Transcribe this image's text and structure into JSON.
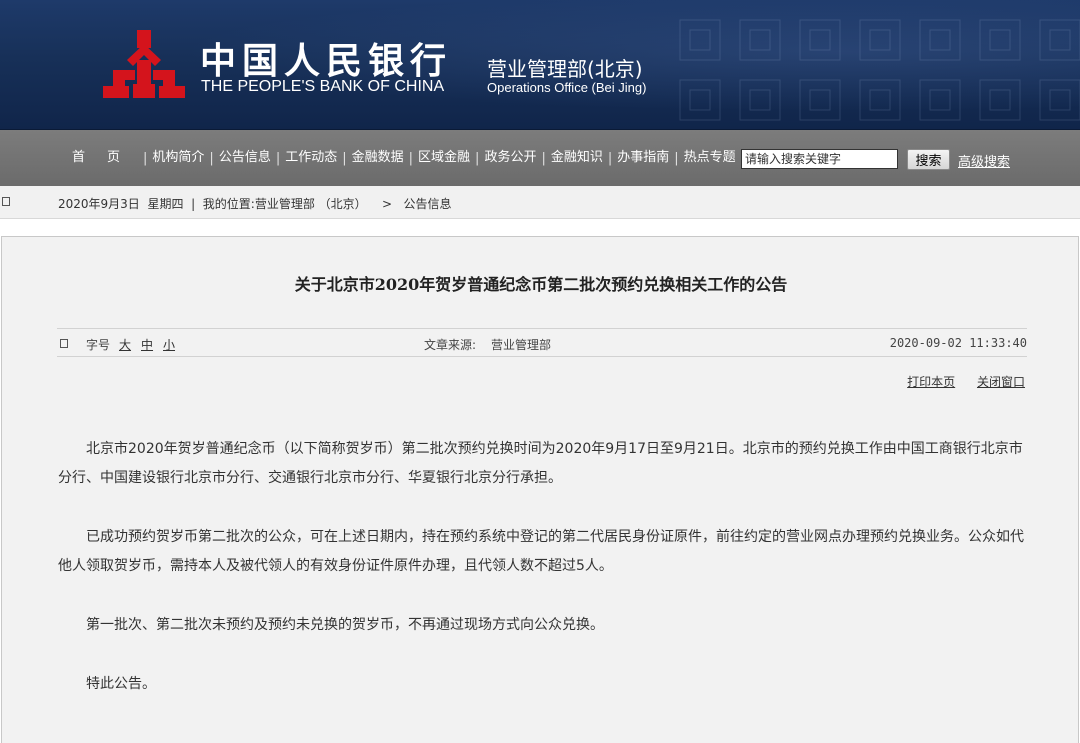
{
  "header": {
    "brand_cn": "中国人民银行",
    "brand_en": "THE PEOPLE'S BANK OF CHINA",
    "dept_cn": "营业管理部(北京)",
    "dept_en": "Operations Office (Bei Jing)",
    "logo_icon": "pboc-logo-icon",
    "colors": {
      "banner": "#173058",
      "logo_red": "#d4141c",
      "nav": "#737373"
    }
  },
  "nav": {
    "items": [
      {
        "label": "首页"
      },
      {
        "label": "机构简介"
      },
      {
        "label": "公告信息"
      },
      {
        "label": "工作动态"
      },
      {
        "label": "金融数据"
      },
      {
        "label": "区域金融"
      },
      {
        "label": "政务公开"
      },
      {
        "label": "金融知识"
      },
      {
        "label": "办事指南"
      },
      {
        "label": "热点专题"
      }
    ],
    "separator": "|",
    "search_placeholder": "请输入搜索关键字",
    "search_button": "搜索",
    "advanced_search": "高级搜索"
  },
  "crumb": {
    "date": "2020年9月3日",
    "weekday": "星期四",
    "separator": "|",
    "location_label": "我的位置:",
    "level1": "营业管理部 （北京）",
    "arrow": ">",
    "level2": "公告信息"
  },
  "article": {
    "title": "关于北京市2020年贺岁普通纪念币第二批次预约兑换相关工作的公告",
    "font_size_label": "字号",
    "font_large": "大",
    "font_medium": "中",
    "font_small": "小",
    "source_label": "文章来源:",
    "source_value": "营业管理部",
    "publish_time": "2020-09-02 11:33:40",
    "print_label": "打印本页",
    "close_label": "关闭窗口",
    "paragraphs": [
      "北京市2020年贺岁普通纪念币（以下简称贺岁币）第二批次预约兑换时间为2020年9月17日至9月21日。北京市的预约兑换工作由中国工商银行北京市分行、中国建设银行北京市分行、交通银行北京市分行、华夏银行北京分行承担。",
      "已成功预约贺岁币第二批次的公众，可在上述日期内，持在预约系统中登记的第二代居民身份证原件，前往约定的营业网点办理预约兑换业务。公众如代他人领取贺岁币，需持本人及被代领人的有效身份证件原件办理，且代领人数不超过5人。",
      "第一批次、第二批次未预约及预约未兑换的贺岁币，不再通过现场方式向公众兑换。",
      "特此公告。"
    ]
  }
}
